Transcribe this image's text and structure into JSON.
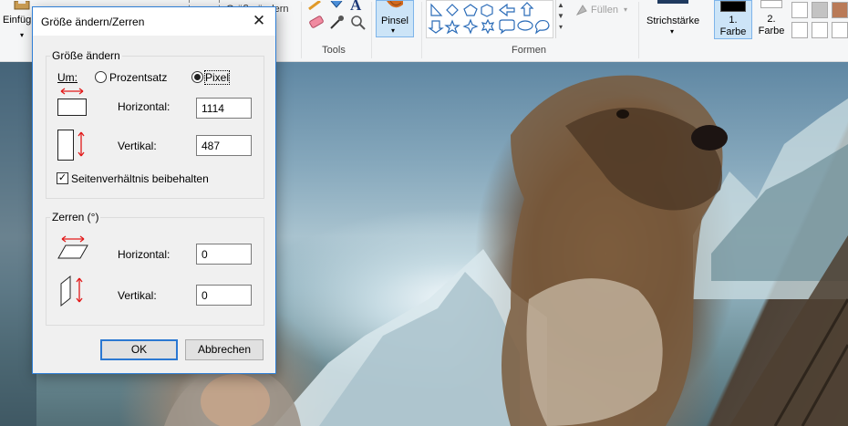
{
  "ribbon": {
    "paste_label": "Einfüg",
    "resize_label": "Größe ändern",
    "clipboard_group_label": "",
    "tools_label": "Tools",
    "brushes_label": "Pinsel",
    "shapes_label": "Formen",
    "fill_label": "Füllen",
    "stroke_label": "Strichstärke",
    "color1_label_line1": "1.",
    "color1_label_line2": "Farbe",
    "color2_label_line1": "2.",
    "color2_label_line2": "Farbe",
    "palette_colors": [
      "#ffffff",
      "#c3c3c3",
      "#b97a57",
      "#ffffff",
      "#ffffff",
      "#ffffff"
    ],
    "color1_value": "#000000",
    "color2_value": "#ffffff",
    "accent": "#cce4f7"
  },
  "dialog": {
    "title": "Größe ändern/Zerren",
    "close_glyph": "✕",
    "resize_group": {
      "legend": "Größe ändern",
      "by_label": "Um:",
      "percent_label": "Prozentsatz",
      "pixel_label": "Pixel",
      "selected": "Pixel",
      "horizontal_label": "Horizontal:",
      "horizontal_value": "1114",
      "vertical_label": "Vertikal:",
      "vertical_value": "487",
      "keep_ratio_label": "Seitenverhältnis beibehalten",
      "keep_ratio_checked": true
    },
    "skew_group": {
      "legend": "Zerren (°)",
      "horizontal_label": "Horizontal:",
      "horizontal_value": "0",
      "vertical_label": "Vertikal:",
      "vertical_value": "0"
    },
    "ok_label": "OK",
    "cancel_label": "Abbrechen"
  }
}
